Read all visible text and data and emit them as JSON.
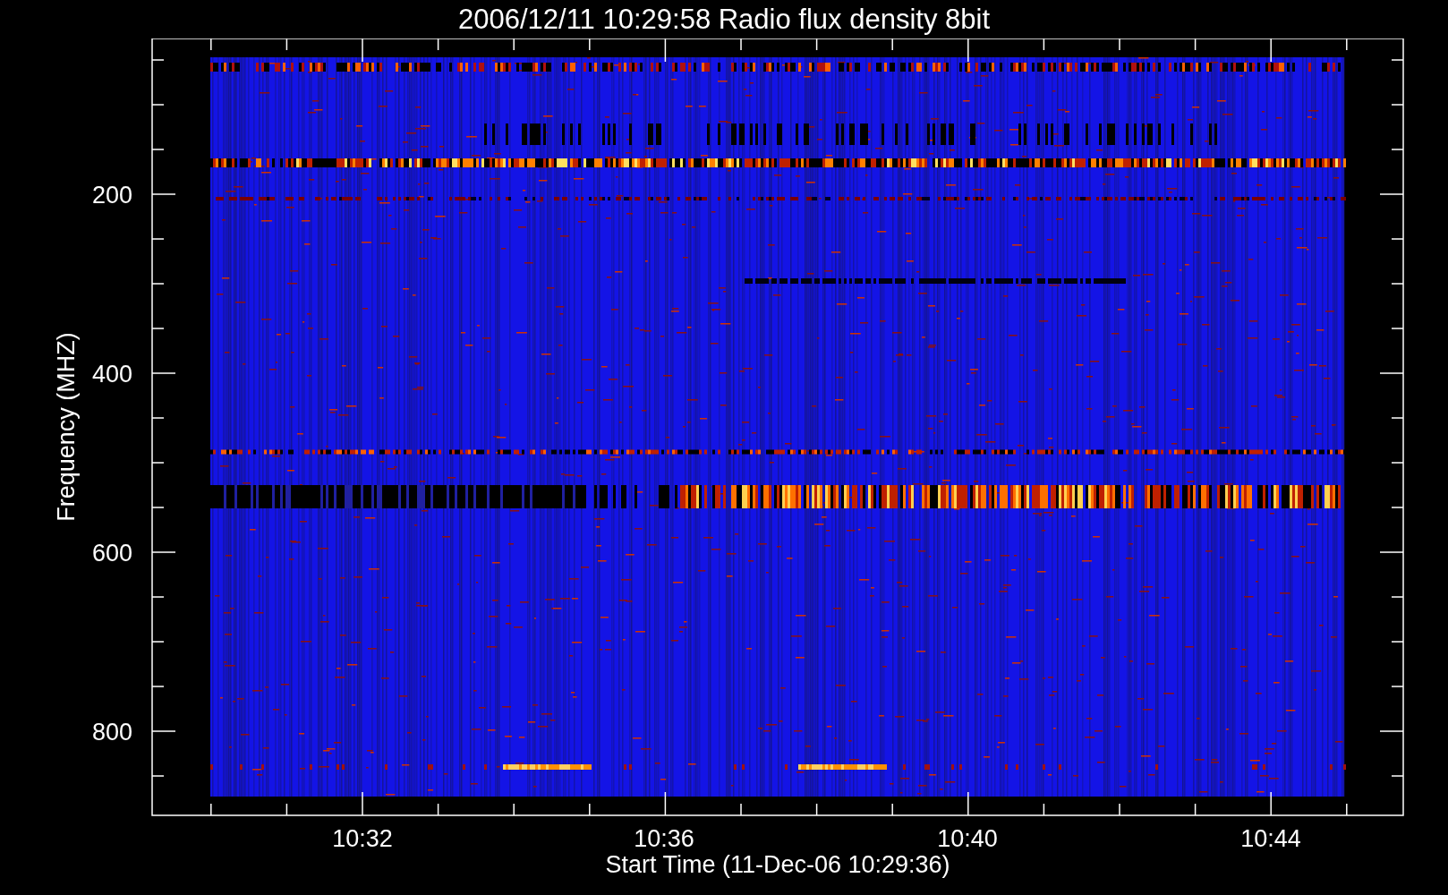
{
  "title": "2006/12/11 10:29:58 Radio flux density 8bit",
  "y_axis": {
    "label": "Frequency (MHZ)",
    "ticks": [
      "200",
      "400",
      "600",
      "800"
    ]
  },
  "x_axis": {
    "label": "Start Time (11-Dec-06 10:29:36)",
    "ticks": [
      "10:32",
      "10:36",
      "10:40",
      "10:44"
    ]
  }
}
